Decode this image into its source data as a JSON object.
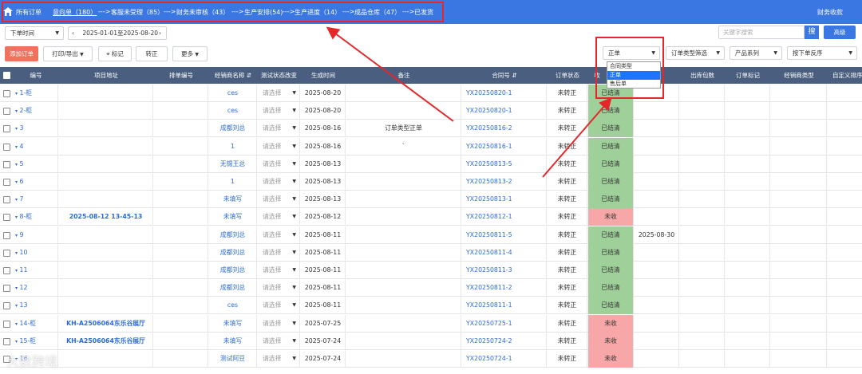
{
  "nav": {
    "items": [
      {
        "label": "所有订单"
      },
      {
        "label": "意向单（180）"
      },
      {
        "label": "客服未受理（85）"
      },
      {
        "label": "财务未审核（43）"
      },
      {
        "label": "生产安排(54)"
      },
      {
        "label": "生产进度（14）"
      },
      {
        "label": "成品仓库（47）"
      },
      {
        "label": "已发货"
      }
    ],
    "arrow": "--->",
    "finance": "财务收款"
  },
  "toolbar": {
    "time_filter": "下单时间",
    "date_range": "2025-01-01至2025-08-20",
    "search_placeholder": "关键字搜索",
    "search_btn": "搜",
    "advanced": "高级",
    "add_order": "添加订单",
    "print_export": "打印/导出",
    "mark": "标记",
    "convert": "转正",
    "more": "更多",
    "order_type": "正单",
    "order_type_filter": "订单类型筛选",
    "product_series": "产品系列",
    "sort": "按下单反序"
  },
  "dropdown": {
    "options": [
      "合同类型",
      "正单",
      "售后单"
    ],
    "highlighted": "正单"
  },
  "table": {
    "headers": [
      "编号",
      "项目地址",
      "排单编号",
      "经销商名称",
      "测试状态改变",
      "生成时间",
      "备注",
      "合同号",
      "订单状态",
      "收",
      "",
      "出库包数",
      "订单标记",
      "经销商类型",
      "自定义排序"
    ],
    "sort_icon": "⇵",
    "select_placeholder": "请选择",
    "rows": [
      {
        "no": "1-柜",
        "addr": "",
        "dealer": "ces",
        "date": "2025-08-20",
        "note": "",
        "contract": "YX20250820-1",
        "status": "未转正",
        "pay": "已结清",
        "pay_state": "settled",
        "out": ""
      },
      {
        "no": "2-柜",
        "addr": "",
        "dealer": "ces",
        "date": "2025-08-20",
        "note": "",
        "contract": "YX20250820-1",
        "status": "未转正",
        "pay": "已结清",
        "pay_state": "settled",
        "out": ""
      },
      {
        "no": "3",
        "addr": "",
        "dealer": "成都刘总",
        "date": "2025-08-16",
        "note": "订单类型正单",
        "contract": "YX20250816-2",
        "status": "未转正",
        "pay": "已结清",
        "pay_state": "settled",
        "out": ""
      },
      {
        "no": "4",
        "addr": "",
        "dealer": "1",
        "date": "2025-08-16",
        "note": "`",
        "contract": "YX20250816-1",
        "status": "未转正",
        "pay": "已结清",
        "pay_state": "settled",
        "out": ""
      },
      {
        "no": "5",
        "addr": "",
        "dealer": "无锡王总",
        "date": "2025-08-13",
        "note": "",
        "contract": "YX20250813-5",
        "status": "未转正",
        "pay": "已结清",
        "pay_state": "settled",
        "out": ""
      },
      {
        "no": "6",
        "addr": "",
        "dealer": "1",
        "date": "2025-08-13",
        "note": "",
        "contract": "YX20250813-2",
        "status": "未转正",
        "pay": "已结清",
        "pay_state": "settled",
        "out": ""
      },
      {
        "no": "7",
        "addr": "",
        "dealer": "未填写",
        "date": "2025-08-13",
        "note": "",
        "contract": "YX20250813-1",
        "status": "未转正",
        "pay": "已结清",
        "pay_state": "settled",
        "out": ""
      },
      {
        "no": "8-柜",
        "addr": "2025-08-12 13-45-13",
        "dealer": "未填写",
        "date": "2025-08-12",
        "note": "",
        "contract": "YX20250812-1",
        "status": "未转正",
        "pay": "未收",
        "pay_state": "unpaid",
        "out": ""
      },
      {
        "no": "9",
        "addr": "",
        "dealer": "成都刘总",
        "date": "2025-08-11",
        "note": "",
        "contract": "YX20250811-5",
        "status": "未转正",
        "pay": "已结清",
        "pay_state": "settled",
        "out": "2025-08-30"
      },
      {
        "no": "10",
        "addr": "",
        "dealer": "成都刘总",
        "date": "2025-08-11",
        "note": "",
        "contract": "YX20250811-4",
        "status": "未转正",
        "pay": "已结清",
        "pay_state": "settled",
        "out": ""
      },
      {
        "no": "11",
        "addr": "",
        "dealer": "成都刘总",
        "date": "2025-08-11",
        "note": "",
        "contract": "YX20250811-3",
        "status": "未转正",
        "pay": "已结清",
        "pay_state": "settled",
        "out": ""
      },
      {
        "no": "12",
        "addr": "",
        "dealer": "成都刘总",
        "date": "2025-08-11",
        "note": "",
        "contract": "YX20250811-2",
        "status": "未转正",
        "pay": "已结清",
        "pay_state": "settled",
        "out": ""
      },
      {
        "no": "13",
        "addr": "",
        "dealer": "ces",
        "date": "2025-08-11",
        "note": "",
        "contract": "YX20250811-1",
        "status": "未转正",
        "pay": "已结清",
        "pay_state": "settled",
        "out": ""
      },
      {
        "no": "14-柜",
        "addr": "KH-A2506064东乐谷展厅",
        "dealer": "未填写",
        "date": "2025-07-25",
        "note": "",
        "contract": "YX20250725-1",
        "status": "未转正",
        "pay": "未收",
        "pay_state": "unpaid",
        "out": ""
      },
      {
        "no": "15-柜",
        "addr": "KH-A2506064东乐谷展厅",
        "dealer": "未填写",
        "date": "2025-07-24",
        "note": "",
        "contract": "YX20250724-2",
        "status": "未转正",
        "pay": "未收",
        "pay_state": "unpaid",
        "out": ""
      },
      {
        "no": "16",
        "addr": "",
        "dealer": "测试阿豆",
        "date": "2025-07-24",
        "note": "",
        "contract": "YX20250724-1",
        "status": "未转正",
        "pay": "未收",
        "pay_state": "unpaid",
        "out": ""
      }
    ]
  },
  "watermark": "大数跨境",
  "colors": {
    "nav_bg": "#3a77e3",
    "header_bg": "#4a5e80",
    "settled": "#9fd09a",
    "unpaid": "#f7a7a7",
    "annotation": "#e5272a"
  }
}
